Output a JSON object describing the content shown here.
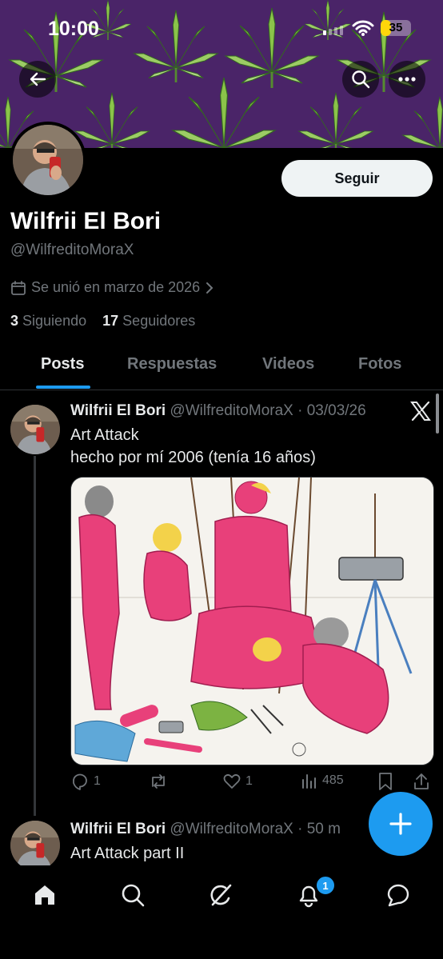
{
  "status_bar": {
    "time": "10:00",
    "battery": "35"
  },
  "profile": {
    "display_name": "Wilfrii El Bori",
    "handle": "@WilfreditoMoraX",
    "joined": "Se unió en marzo de 2026",
    "following_count": "3",
    "following_label": "Siguiendo",
    "followers_count": "17",
    "followers_label": "Seguidores",
    "follow_button": "Seguir"
  },
  "tabs": [
    {
      "label": "Posts",
      "active": true
    },
    {
      "label": "Respuestas",
      "active": false
    },
    {
      "label": "Videos",
      "active": false
    },
    {
      "label": "Fotos",
      "active": false
    }
  ],
  "posts": [
    {
      "name": "Wilfrii El Bori",
      "handle": "@WilfreditoMoraX",
      "time": "· 03/03/26",
      "line1": "Art Attack",
      "line2": "hecho por mí 2006 (tenía 16 años)",
      "replies": "1",
      "reposts": "",
      "likes": "1",
      "views": "485"
    },
    {
      "name": "Wilfrii El Bori",
      "handle": "@WilfreditoMoraX",
      "time": "· 50 m",
      "line1": "Art Attack part II"
    }
  ],
  "bottom_nav": {
    "notifications_badge": "1"
  },
  "colors": {
    "accent": "#1d9bf0",
    "banner": "#4a2468",
    "leaf": "#7cb342"
  }
}
